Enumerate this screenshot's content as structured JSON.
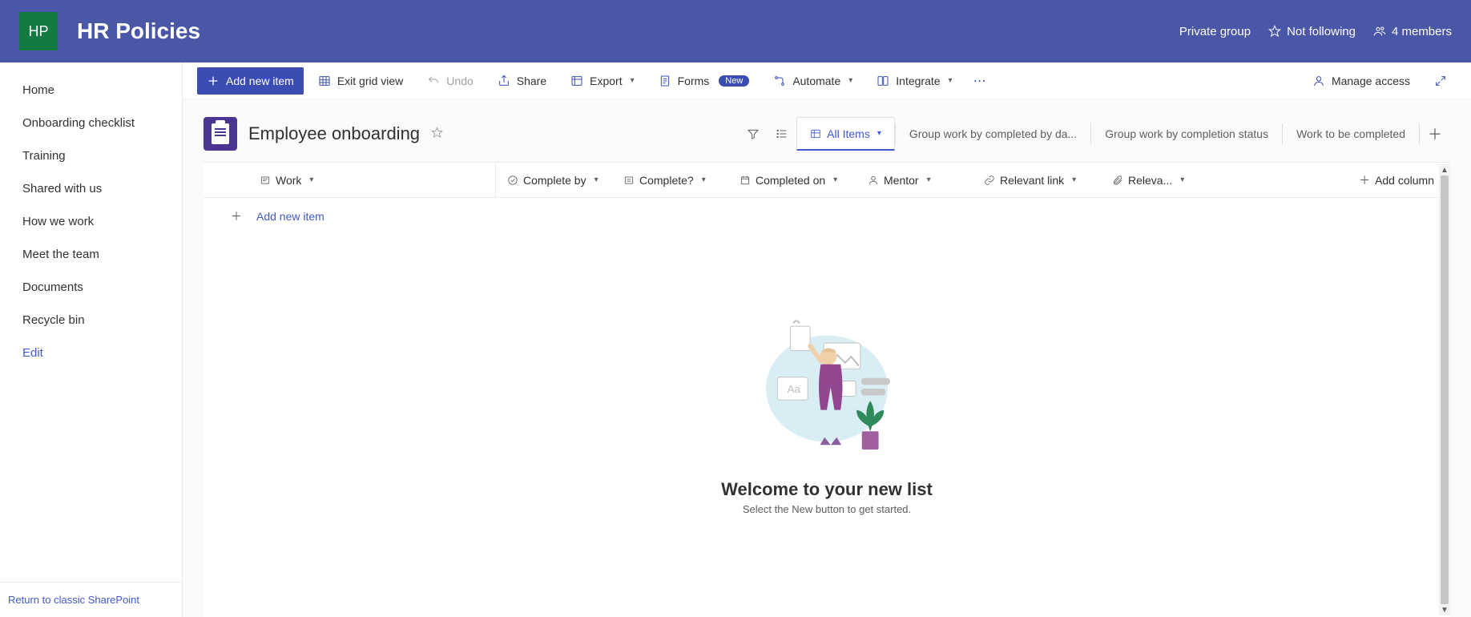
{
  "header": {
    "logo_initials": "HP",
    "site_title": "HR Policies",
    "privacy": "Private group",
    "not_following": "Not following",
    "members": "4 members"
  },
  "sidebar": {
    "items": [
      {
        "label": "Home"
      },
      {
        "label": "Onboarding checklist"
      },
      {
        "label": "Training"
      },
      {
        "label": "Shared with us"
      },
      {
        "label": "How we work"
      },
      {
        "label": "Meet the team"
      },
      {
        "label": "Documents"
      },
      {
        "label": "Recycle bin"
      }
    ],
    "edit": "Edit",
    "return_classic": "Return to classic SharePoint"
  },
  "command_bar": {
    "add_new_item": "Add new item",
    "exit_grid": "Exit grid view",
    "undo": "Undo",
    "share": "Share",
    "export": "Export",
    "forms": "Forms",
    "forms_badge": "New",
    "automate": "Automate",
    "integrate": "Integrate",
    "manage_access": "Manage access"
  },
  "list": {
    "title": "Employee onboarding"
  },
  "views": {
    "active": "All Items",
    "tabs": [
      "Group work by completed by da...",
      "Group work by completion status",
      "Work to be completed"
    ]
  },
  "columns": {
    "work": "Work",
    "complete_by": "Complete by",
    "complete_q": "Complete?",
    "completed_on": "Completed on",
    "mentor": "Mentor",
    "relevant_link": "Relevant link",
    "releva_trunc": "Releva...",
    "add_column": "Add column"
  },
  "add_row": {
    "label": "Add new item"
  },
  "empty_state": {
    "title": "Welcome to your new list",
    "subtitle": "Select the New button to get started."
  }
}
